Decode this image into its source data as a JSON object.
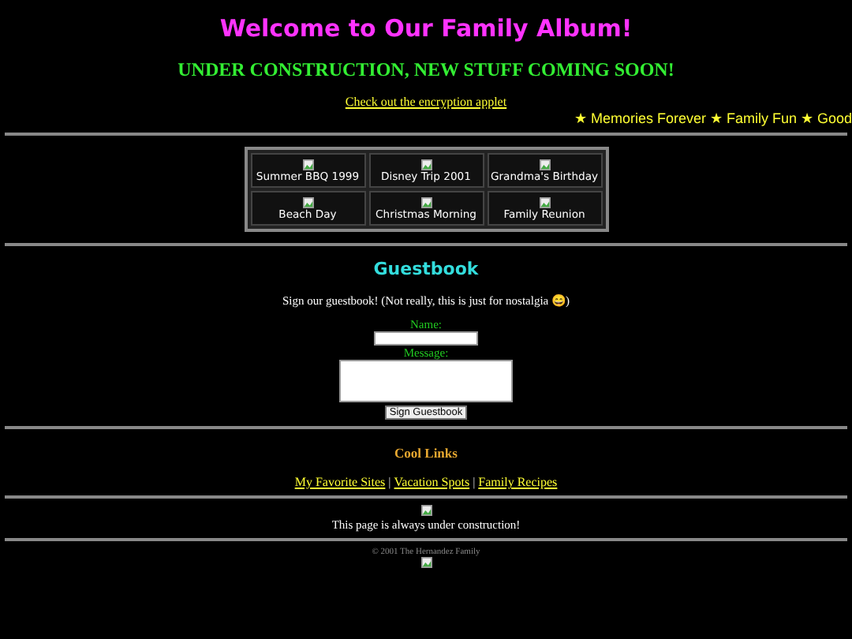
{
  "title": "Welcome to Our Family Album!",
  "banner": "UNDER CONSTRUCTION, NEW STUFF COMING SOON!",
  "applet_link": "Check out the encryption applet",
  "marquee": "★ Memories Forever ★ Family Fun ★ Good",
  "album": [
    {
      "caption": "Summer BBQ 1999"
    },
    {
      "caption": "Disney Trip 2001"
    },
    {
      "caption": "Grandma's Birthday"
    },
    {
      "caption": "Beach Day"
    },
    {
      "caption": "Christmas Morning"
    },
    {
      "caption": "Family Reunion"
    }
  ],
  "guestbook": {
    "heading": "Guestbook",
    "intro": "Sign our guestbook! (Not really, this is just for nostalgia 😄)",
    "name_label": "Name:",
    "message_label": "Message:",
    "button": "Sign Guestbook"
  },
  "cool_links": {
    "heading": "Cool Links",
    "links": [
      "My Favorite Sites",
      "Vacation Spots",
      "Family Recipes"
    ],
    "separator": "|"
  },
  "construction_note": "This page is always under construction!",
  "copyright": "© 2001 The Hernandez Family"
}
